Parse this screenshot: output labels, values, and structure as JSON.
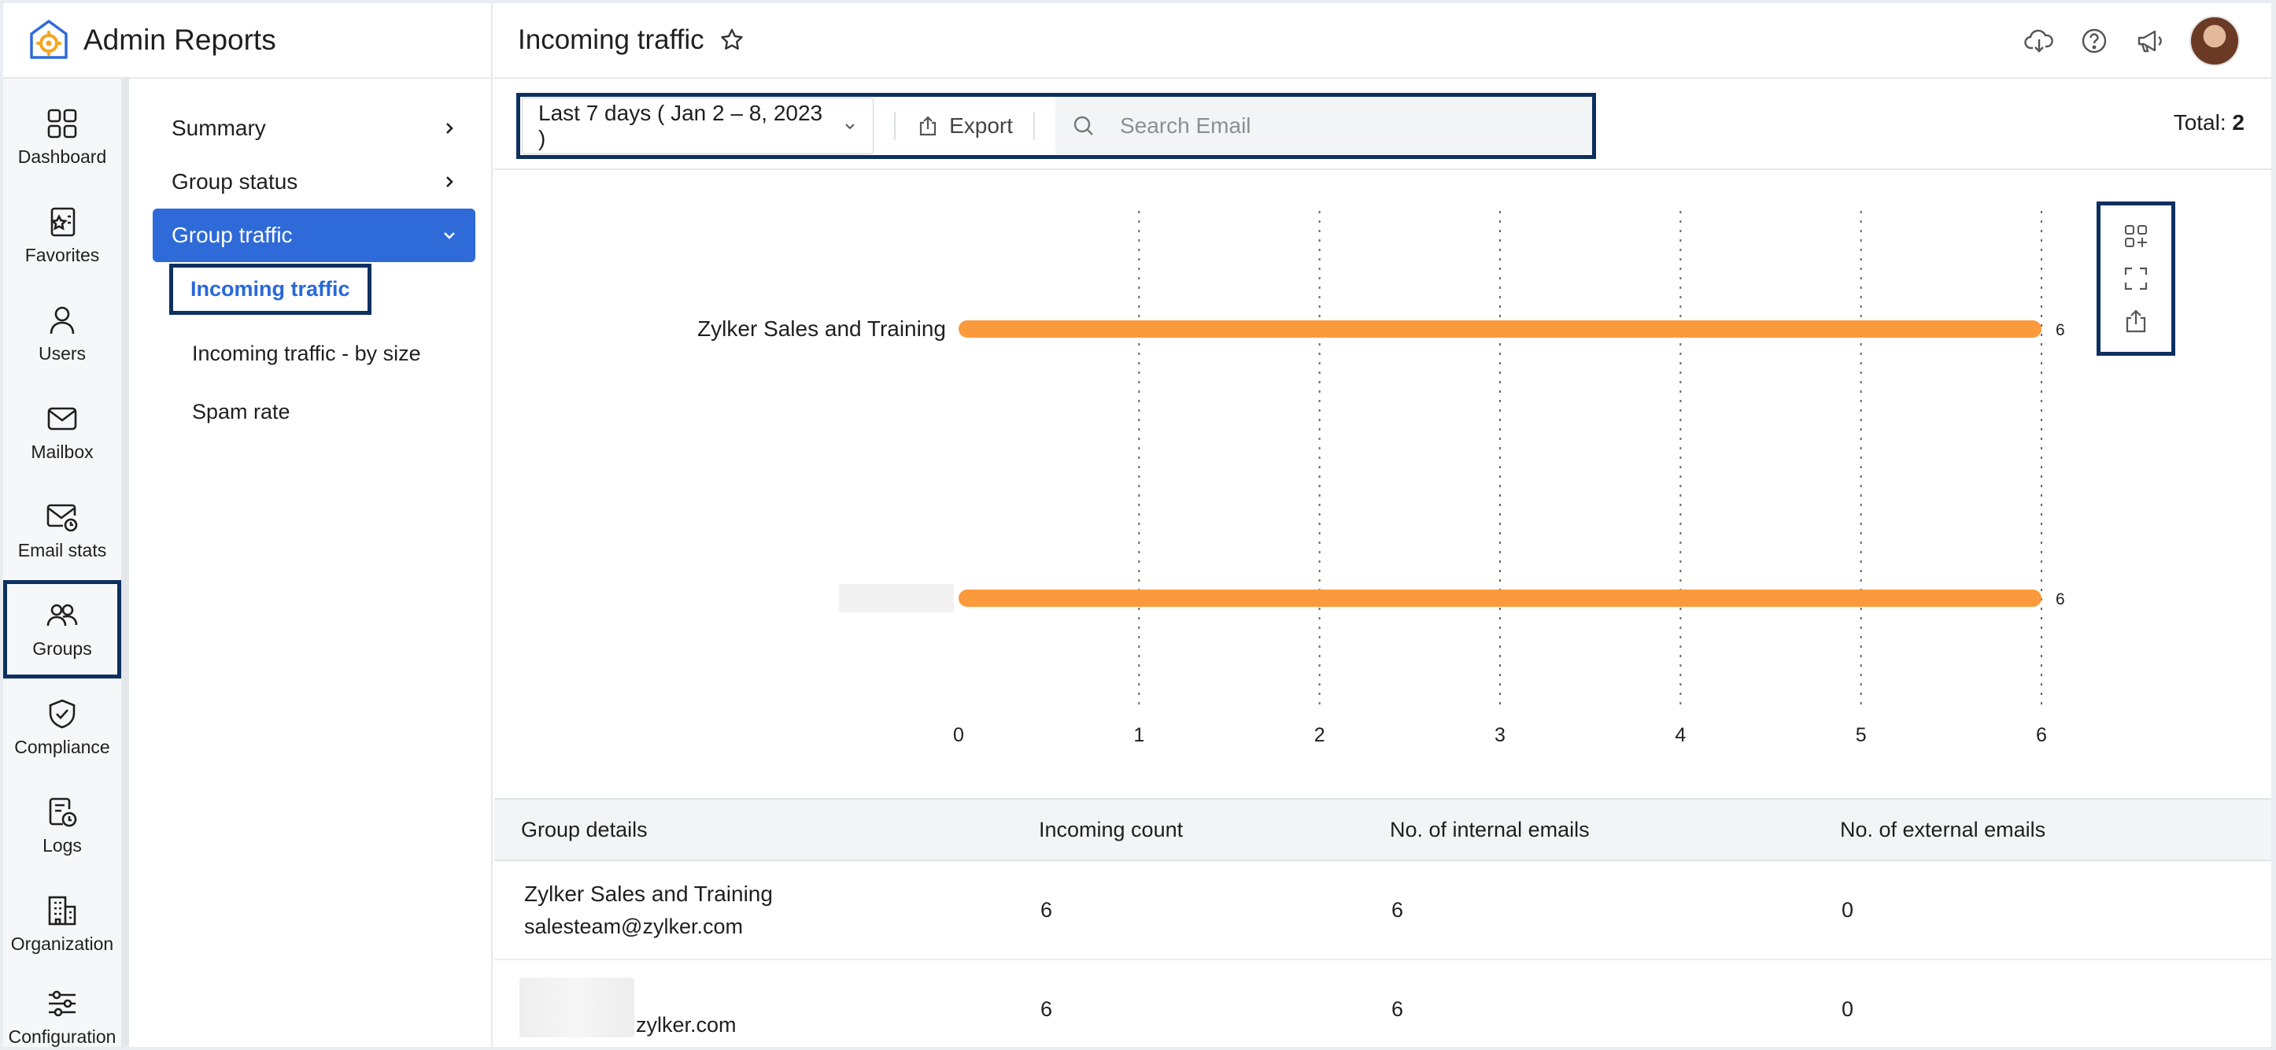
{
  "app": {
    "title": "Admin Reports"
  },
  "rail": [
    {
      "label": "Dashboard",
      "icon": "dashboard-icon"
    },
    {
      "label": "Favorites",
      "icon": "favorites-icon"
    },
    {
      "label": "Users",
      "icon": "users-icon"
    },
    {
      "label": "Mailbox",
      "icon": "mailbox-icon"
    },
    {
      "label": "Email stats",
      "icon": "email-stats-icon"
    },
    {
      "label": "Groups",
      "icon": "groups-icon",
      "selected": true
    },
    {
      "label": "Compliance",
      "icon": "compliance-icon"
    },
    {
      "label": "Logs",
      "icon": "logs-icon"
    },
    {
      "label": "Organization",
      "icon": "organization-icon"
    },
    {
      "label": "Configuration",
      "icon": "configuration-icon"
    }
  ],
  "submenu": {
    "items": [
      {
        "label": "Summary"
      },
      {
        "label": "Group status"
      },
      {
        "label": "Group traffic",
        "active": true
      }
    ],
    "children": [
      {
        "label": "Incoming traffic",
        "current": true
      },
      {
        "label": "Incoming traffic - by size"
      },
      {
        "label": "Spam rate"
      }
    ]
  },
  "header": {
    "title": "Incoming traffic"
  },
  "toolbar": {
    "date_range": "Last 7 days ( Jan 2 – 8, 2023 )",
    "export_label": "Export",
    "search_placeholder": "Search Email",
    "total_label": "Total:",
    "total_value": "2"
  },
  "colors": {
    "accent": "#2e6ad8",
    "bar": "#fb9a3c",
    "highlight": "#0d3060"
  },
  "chart_data": {
    "type": "bar",
    "orientation": "horizontal",
    "categories": [
      "Zylker Sales and Training",
      ""
    ],
    "values": [
      6,
      6
    ],
    "data_labels": [
      "6",
      "6"
    ],
    "xlim": [
      0,
      6
    ],
    "x_ticks": [
      "0",
      "1",
      "2",
      "3",
      "4",
      "5",
      "6"
    ],
    "grid": "vertical-dotted"
  },
  "table": {
    "headers": [
      "Group details",
      "Incoming count",
      "No. of internal emails",
      "No. of external emails"
    ],
    "rows": [
      {
        "name": "Zylker Sales and Training",
        "email": "salesteam@zylker.com",
        "incoming": "6",
        "internal": "6",
        "external": "0"
      },
      {
        "name": "",
        "email": "zylker.com",
        "incoming": "6",
        "internal": "6",
        "external": "0"
      }
    ]
  }
}
